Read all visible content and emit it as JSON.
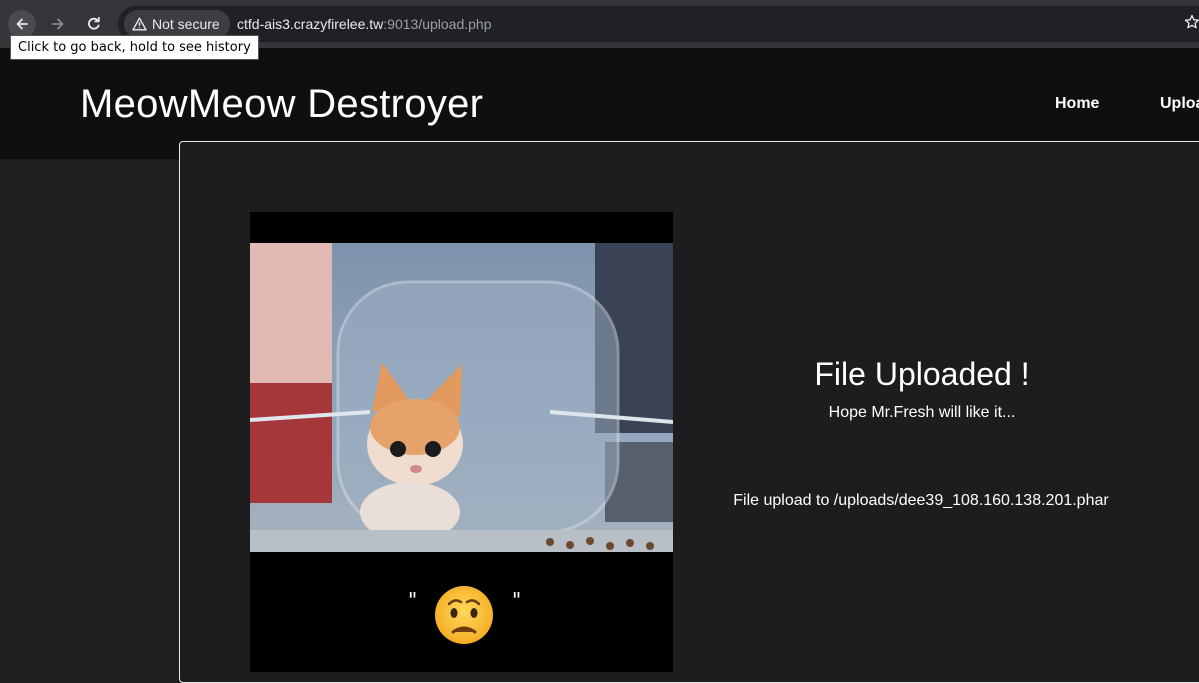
{
  "browser": {
    "security_label": "Not secure",
    "url_host": "ctfd-ais3.crazyfirelee.tw",
    "url_path": ":9013/upload.php",
    "tooltip": "Click to go back, hold to see history",
    "icons": [
      "back-arrow-icon",
      "forward-arrow-icon",
      "reload-icon",
      "warning-icon",
      "star-icon"
    ]
  },
  "site": {
    "title": "MeowMeow Destroyer",
    "nav": {
      "home": "Home",
      "upload": "Uploa"
    }
  },
  "result": {
    "title": "File Uploaded !",
    "subtitle": "Hope Mr.Fresh will like it...",
    "path_text": "File upload to /uploads/dee39_108.160.138.201.phar"
  },
  "gif": {
    "caption_left": "\"",
    "caption_right": "\""
  }
}
